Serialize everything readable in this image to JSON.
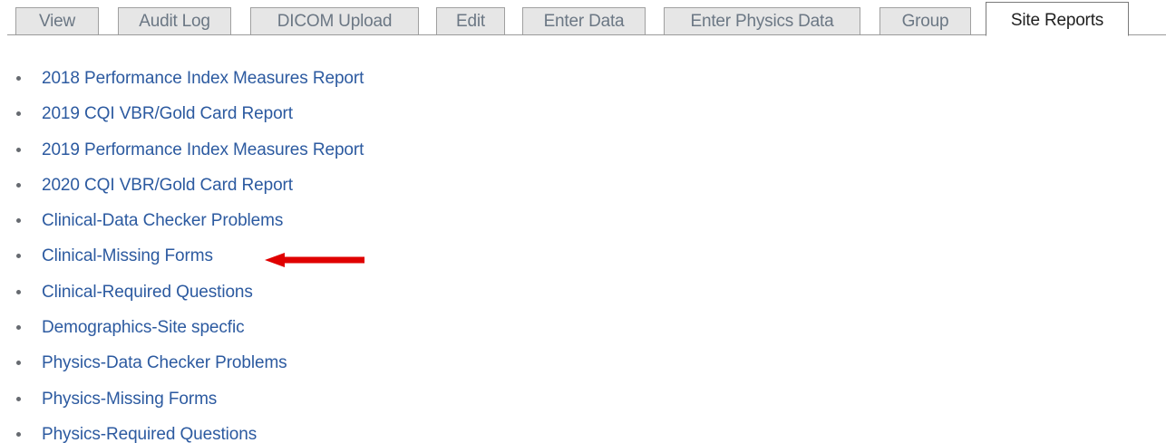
{
  "tabs": [
    {
      "label": "View"
    },
    {
      "label": "Audit Log"
    },
    {
      "label": "DICOM Upload"
    },
    {
      "label": "Edit"
    },
    {
      "label": "Enter Data"
    },
    {
      "label": "Enter Physics Data"
    },
    {
      "label": "Group"
    },
    {
      "label": "Site Reports",
      "active": true
    }
  ],
  "reports": [
    {
      "label": "2018 Performance Index Measures Report"
    },
    {
      "label": "2019 CQI VBR/Gold Card Report"
    },
    {
      "label": "2019 Performance Index Measures Report"
    },
    {
      "label": "2020 CQI VBR/Gold Card Report"
    },
    {
      "label": "Clinical-Data Checker Problems"
    },
    {
      "label": "Clinical-Missing Forms"
    },
    {
      "label": "Clinical-Required Questions"
    },
    {
      "label": "Demographics-Site specfic"
    },
    {
      "label": "Physics-Data Checker Problems"
    },
    {
      "label": "Physics-Missing Forms"
    },
    {
      "label": "Physics-Required Questions"
    }
  ],
  "annotation": {
    "icon": "arrow-left-icon",
    "color": "#e00000",
    "points_to": "Clinical-Missing Forms"
  },
  "colors": {
    "link": "#2c5aa0",
    "tab_inactive_bg": "#e6e6e6",
    "tab_inactive_text": "#6b7784",
    "tab_active_text": "#1f1f1f"
  }
}
